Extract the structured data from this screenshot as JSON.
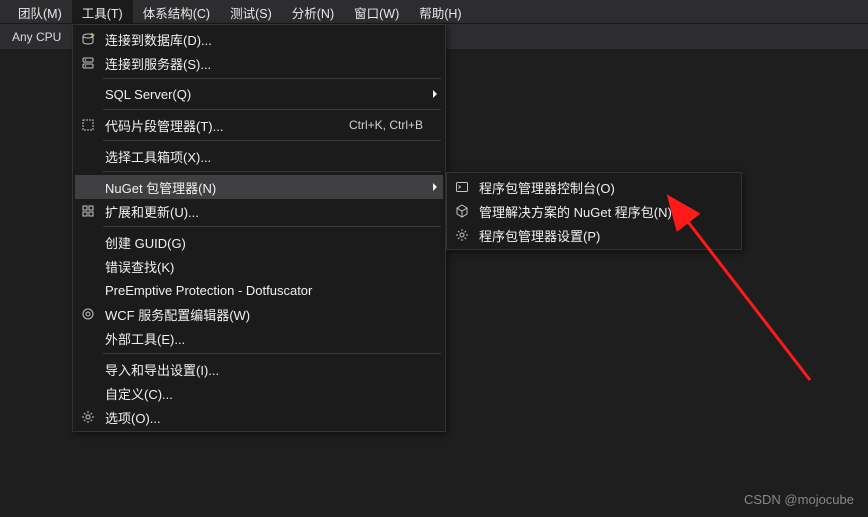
{
  "menubar": {
    "items": [
      {
        "label": "团队(M)"
      },
      {
        "label": "工具(T)",
        "active": true
      },
      {
        "label": "体系结构(C)"
      },
      {
        "label": "测试(S)"
      },
      {
        "label": "分析(N)"
      },
      {
        "label": "窗口(W)"
      },
      {
        "label": "帮助(H)"
      }
    ]
  },
  "toolbar": {
    "config_label": "Any CPU"
  },
  "tools_menu": {
    "items": [
      {
        "icon": "db-connect",
        "label": "连接到数据库(D)..."
      },
      {
        "icon": "server-connect",
        "label": "连接到服务器(S)..."
      },
      {
        "sep": true
      },
      {
        "label": "SQL Server(Q)",
        "submenu": true
      },
      {
        "sep": true
      },
      {
        "icon": "snippet",
        "label": "代码片段管理器(T)...",
        "shortcut": "Ctrl+K, Ctrl+B"
      },
      {
        "sep": true
      },
      {
        "label": "选择工具箱项(X)..."
      },
      {
        "sep": true
      },
      {
        "label": "NuGet 包管理器(N)",
        "submenu": true,
        "highlighted": true
      },
      {
        "icon": "extensions",
        "label": "扩展和更新(U)..."
      },
      {
        "sep": true
      },
      {
        "label": "创建 GUID(G)"
      },
      {
        "label": "错误查找(K)"
      },
      {
        "label": "PreEmptive Protection - Dotfuscator"
      },
      {
        "icon": "wcf",
        "label": "WCF 服务配置编辑器(W)"
      },
      {
        "label": "外部工具(E)..."
      },
      {
        "sep": true
      },
      {
        "label": "导入和导出设置(I)..."
      },
      {
        "label": "自定义(C)..."
      },
      {
        "icon": "gear",
        "label": "选项(O)..."
      }
    ]
  },
  "nuget_submenu": {
    "items": [
      {
        "icon": "console",
        "label": "程序包管理器控制台(O)"
      },
      {
        "icon": "package",
        "label": "管理解决方案的 NuGet 程序包(N)..."
      },
      {
        "icon": "gear",
        "label": "程序包管理器设置(P)"
      }
    ]
  },
  "watermark": "CSDN @mojocube"
}
